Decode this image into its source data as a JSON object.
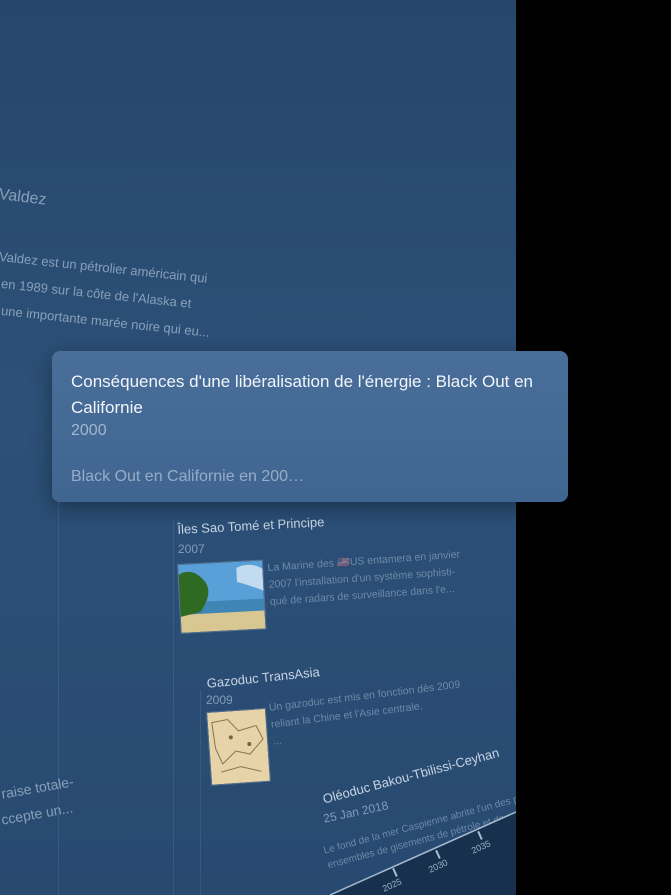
{
  "background": {
    "left_title": "Valdez",
    "left_lines": [
      "Valdez est un pétrolier américain qui",
      "en 1989 sur la côte de l'Alaska et",
      "une importante marée noire qui eu..."
    ],
    "bottom_left_lines": [
      "raise totale-",
      "ccepte un..."
    ]
  },
  "card": {
    "title": "Conséquences d'une libéralisation de l'énergie : Black Out en Californie",
    "year": "2000",
    "description": "Black Out en Californie en 200…"
  },
  "items": [
    {
      "title": "Îles Sao Tomé et Principe",
      "year": "2007",
      "desc": [
        "La Marine des 🇺🇸US entamera en janvier",
        "2007 l'installation d'un système sophisti-",
        "qué de radars de surveillance dans l'e..."
      ]
    },
    {
      "title": "Gazoduc TransAsia",
      "year": "2009",
      "desc": [
        "Un gazoduc est mis en fonction dès 2009",
        "reliant la Chine et l'Asie centrale.",
        "..."
      ]
    },
    {
      "title": "Oléoduc Bakou-Tbilissi-Ceyhan",
      "year": "25 Jan 2018",
      "desc": [
        "Le fond de la mer Caspienne abrite l'un des plus importants",
        "ensembles de gisements de pétrole et de gaz au monde..."
      ]
    }
  ],
  "axis": {
    "labels": [
      "2025",
      "2030",
      "2035"
    ]
  }
}
